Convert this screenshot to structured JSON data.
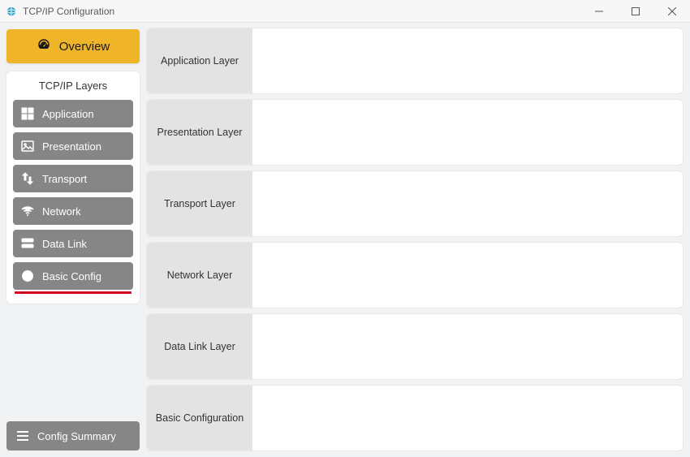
{
  "window": {
    "title": "TCP/IP Configuration"
  },
  "sidebar": {
    "overview_label": "Overview",
    "layers_title": "TCP/IP Layers",
    "items": [
      {
        "label": "Application"
      },
      {
        "label": "Presentation"
      },
      {
        "label": "Transport"
      },
      {
        "label": "Network"
      },
      {
        "label": "Data Link"
      },
      {
        "label": "Basic Config"
      }
    ],
    "summary_label": "Config Summary"
  },
  "main": {
    "rows": [
      {
        "label": "Application Layer"
      },
      {
        "label": "Presentation Layer"
      },
      {
        "label": "Transport Layer"
      },
      {
        "label": "Network Layer"
      },
      {
        "label": "Data Link Layer"
      },
      {
        "label": "Basic Configuration"
      }
    ]
  }
}
